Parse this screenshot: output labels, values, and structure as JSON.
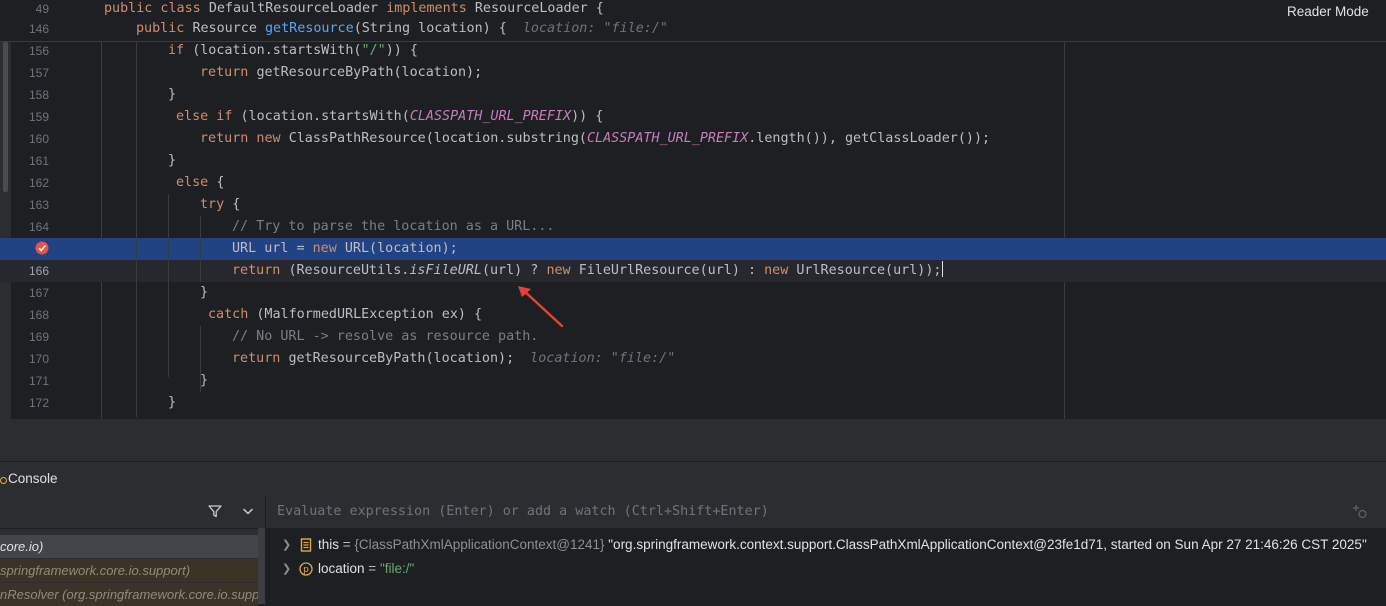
{
  "header": {
    "reader_mode": "Reader Mode"
  },
  "sticky_lines": [
    {
      "num": "49",
      "tokens": [
        [
          "kw",
          "public class "
        ],
        [
          "p",
          "DefaultResourceLoader "
        ],
        [
          "kw",
          "implements "
        ],
        [
          "p",
          "ResourceLoader {"
        ]
      ]
    },
    {
      "num": "146",
      "tokens": [
        [
          "kw",
          "public "
        ],
        [
          "p",
          "Resource "
        ],
        [
          "fn",
          "getResource"
        ],
        [
          "p",
          "(String location) {"
        ]
      ],
      "hint": "location: \"file:/\""
    }
  ],
  "code_lines": [
    {
      "num": "156",
      "tokens": [
        [
          "kw",
          "if "
        ],
        [
          "p",
          "(location.startsWith("
        ],
        [
          "str",
          "\"/\""
        ],
        [
          "p",
          ")) {"
        ]
      ]
    },
    {
      "num": "157",
      "tokens": [
        [
          "kw",
          "return "
        ],
        [
          "p",
          "getResourceByPath(location);"
        ]
      ]
    },
    {
      "num": "158",
      "tokens": [
        [
          "p",
          "}"
        ]
      ]
    },
    {
      "num": "159",
      "tokens": [
        [
          "kw",
          "else if "
        ],
        [
          "p",
          "(location.startsWith("
        ],
        [
          "const",
          "CLASSPATH_URL_PREFIX"
        ],
        [
          "p",
          ")) {"
        ]
      ]
    },
    {
      "num": "160",
      "tokens": [
        [
          "kw",
          "return new "
        ],
        [
          "p",
          "ClassPathResource(location.substring("
        ],
        [
          "const",
          "CLASSPATH_URL_PREFIX"
        ],
        [
          "p",
          ".length()), getClassLoader());"
        ]
      ]
    },
    {
      "num": "161",
      "tokens": [
        [
          "p",
          "}"
        ]
      ]
    },
    {
      "num": "162",
      "tokens": [
        [
          "kw",
          "else "
        ],
        [
          "p",
          "{"
        ]
      ]
    },
    {
      "num": "163",
      "tokens": [
        [
          "kw",
          "try "
        ],
        [
          "p",
          "{"
        ]
      ]
    },
    {
      "num": "164",
      "tokens": [
        [
          "cm",
          "// Try to parse the location as a URL..."
        ]
      ]
    },
    {
      "num": "",
      "tokens": [
        [
          "p",
          "URL url = "
        ],
        [
          "kw",
          "new "
        ],
        [
          "p",
          "URL(location);"
        ]
      ]
    },
    {
      "num": "166",
      "tokens": [
        [
          "kw",
          "return "
        ],
        [
          "p",
          "(ResourceUtils."
        ],
        [
          "it",
          "isFileURL"
        ],
        [
          "p",
          "(url) ? "
        ],
        [
          "kw",
          "new "
        ],
        [
          "p",
          "FileUrlResource(url) : "
        ],
        [
          "kw",
          "new "
        ],
        [
          "p",
          "UrlResource(url));"
        ]
      ]
    },
    {
      "num": "167",
      "tokens": [
        [
          "p",
          "}"
        ]
      ]
    },
    {
      "num": "168",
      "tokens": [
        [
          "kw",
          "catch "
        ],
        [
          "p",
          "(MalformedURLException ex) {"
        ]
      ]
    },
    {
      "num": "169",
      "tokens": [
        [
          "cm",
          "// No URL -> resolve as resource path."
        ]
      ]
    },
    {
      "num": "170",
      "tokens": [
        [
          "kw",
          "return "
        ],
        [
          "p",
          "getResourceByPath(location);"
        ]
      ],
      "hint": "location: \"file:/\""
    },
    {
      "num": "171",
      "tokens": [
        [
          "p",
          "}"
        ]
      ]
    },
    {
      "num": "172",
      "tokens": [
        [
          "p",
          "}"
        ]
      ]
    }
  ],
  "console": {
    "tab_label": "Console"
  },
  "frames": [
    {
      "label": "core.io)"
    },
    {
      "label": "springframework.core.io.support)"
    },
    {
      "label": "nResolver (org.springframework.core.io.supp"
    }
  ],
  "eval": {
    "placeholder": "Evaluate expression (Enter) or add a watch (Ctrl+Shift+Enter)"
  },
  "variables": [
    {
      "icon": "field-icon",
      "name": "this",
      "eq": " = ",
      "ref": "{ClassPathXmlApplicationContext@1241} ",
      "value": "\"org.springframework.context.support.ClassPathXmlApplicationContext@23fe1d71, started on Sun Apr 27 21:46:26 CST 2025\""
    },
    {
      "icon": "parameter-icon",
      "name": "location",
      "eq": " = ",
      "ref": "",
      "value": "\"file:/\""
    }
  ],
  "colors": {
    "editor_bg": "#1e1f22",
    "panel_bg": "#2b2d30",
    "execution_line": "#214283",
    "keyword": "#cf8e6d",
    "method": "#56a8f5",
    "string": "#6aab73",
    "constant": "#c77dbb",
    "comment": "#7a7e85",
    "arrow": "#e8413c"
  }
}
